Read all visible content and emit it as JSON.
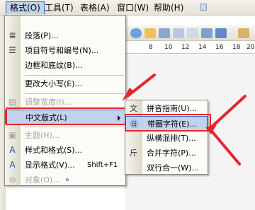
{
  "menubar": {
    "items": [
      {
        "label": "格式(O)"
      },
      {
        "label": "工具(T)"
      },
      {
        "label": "表格(A)"
      },
      {
        "label": "窗口(W)"
      },
      {
        "label": "帮助(H)"
      }
    ]
  },
  "ruler": {
    "numbers": [
      "8",
      "10",
      "12",
      "14",
      "16",
      "18",
      "20"
    ]
  },
  "format_menu": {
    "items": [
      {
        "label": "段落(P)...",
        "icon": "paragraph-icon",
        "disabled": false
      },
      {
        "label": "项目符号和编号(N)...",
        "icon": "bullets-icon",
        "disabled": false
      },
      {
        "label": "边框和底纹(B)...",
        "icon": "",
        "disabled": false
      },
      {
        "label": "更改大小写(E)...",
        "icon": "",
        "disabled": false
      },
      {
        "label": "调整宽度(I)...",
        "icon": "adjust-width-icon",
        "disabled": true
      },
      {
        "label": "中文版式(L)",
        "icon": "",
        "disabled": false
      },
      {
        "label": "主题(H)...",
        "icon": "theme-icon",
        "disabled": true
      },
      {
        "label": "样式和格式(S)...",
        "icon": "styles-icon",
        "disabled": false
      },
      {
        "label": "显示格式(V)...",
        "icon": "reveal-format-icon",
        "disabled": false,
        "shortcut": "Shift+F1"
      },
      {
        "label": "对象(O)...",
        "icon": "object-icon",
        "disabled": true
      }
    ],
    "more_icon": "chevron-double-down-icon"
  },
  "submenu": {
    "items": [
      {
        "label": "拼音指南(U)...",
        "icon": "phonetic-guide-icon"
      },
      {
        "label": "带圈字符(E)...",
        "icon": "enclose-characters-icon"
      },
      {
        "label": "纵横混排(T)...",
        "icon": ""
      },
      {
        "label": "合并字符(P)...",
        "icon": "combine-characters-icon"
      },
      {
        "label": "双行合一(W)...",
        "icon": ""
      }
    ]
  },
  "colors": {
    "highlight": "#c1d2ee",
    "highlight_border": "#316ac5",
    "annotation_red": "#e8252c"
  }
}
